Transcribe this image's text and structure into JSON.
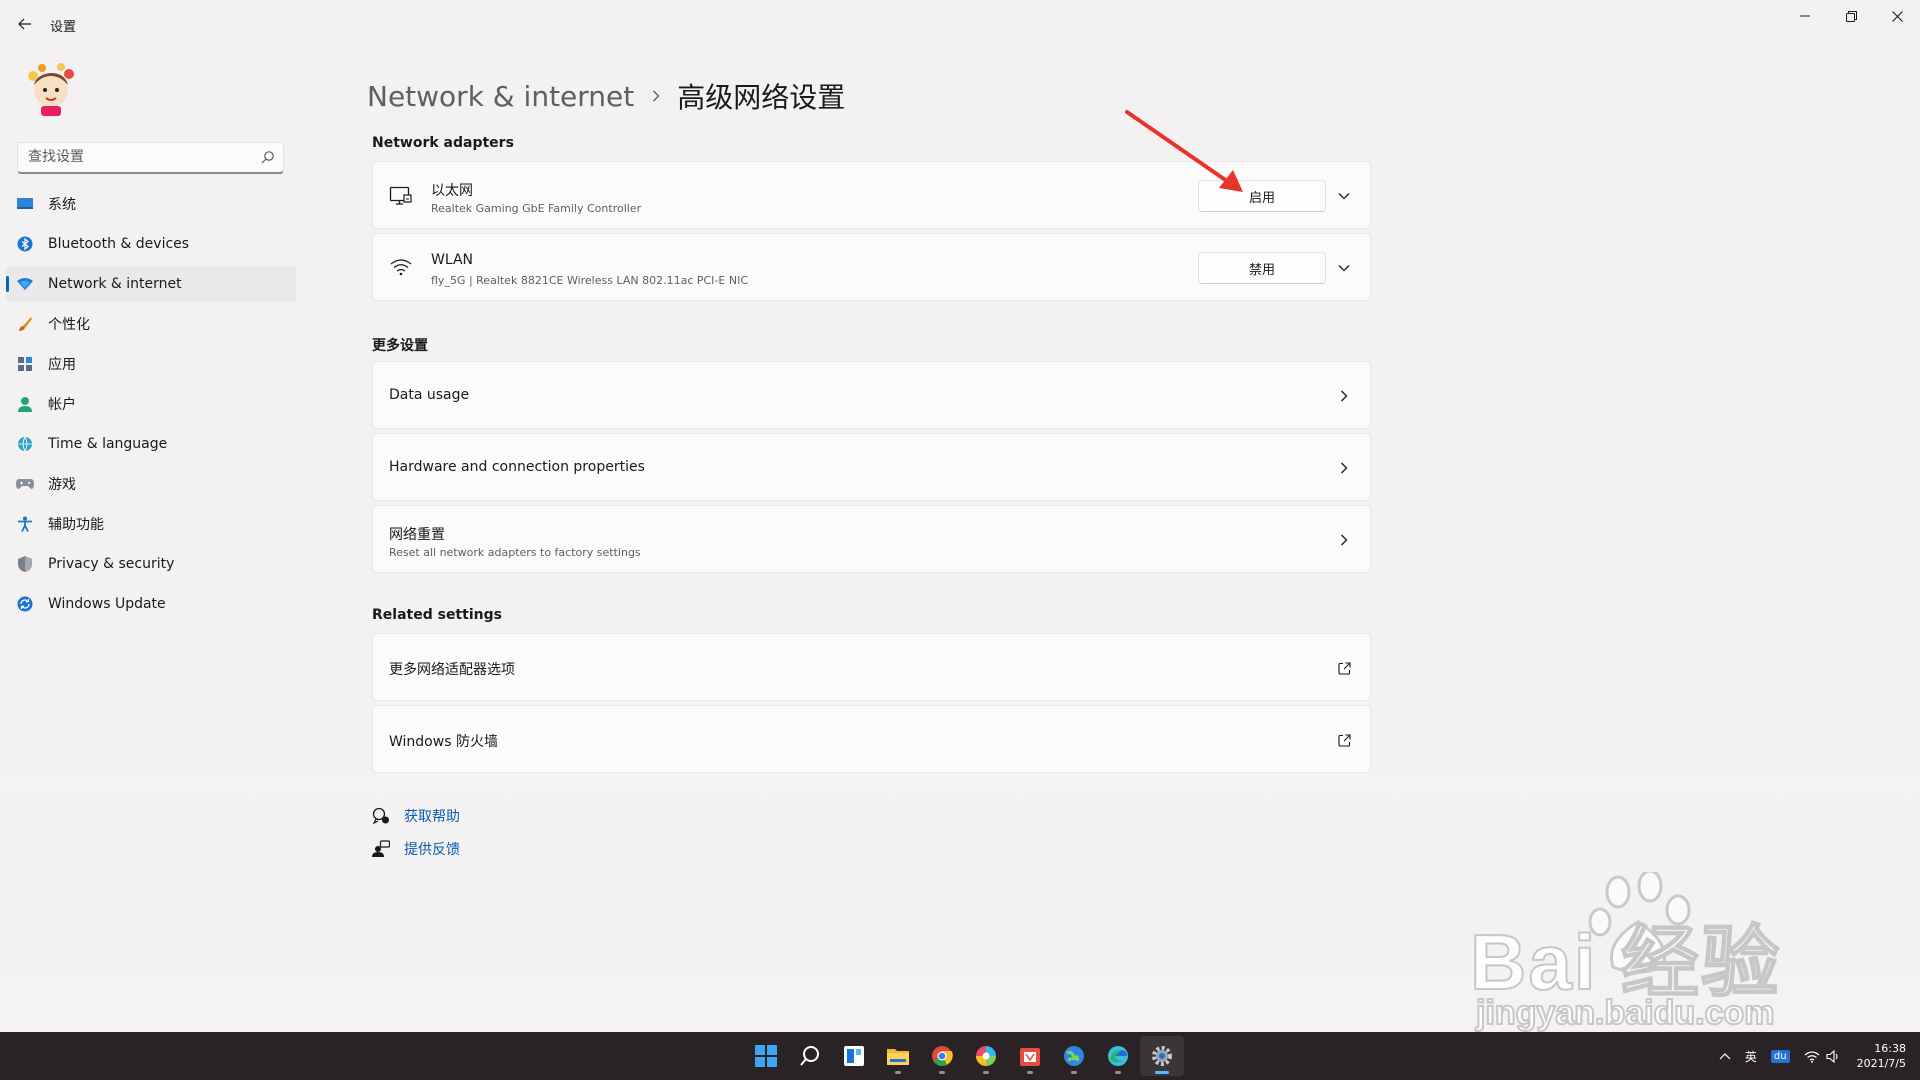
{
  "window": {
    "title": "设置"
  },
  "search": {
    "placeholder": "查找设置"
  },
  "sidebar": {
    "items": [
      {
        "label": "系统",
        "icon": "monitor-icon",
        "active": false
      },
      {
        "label": "Bluetooth & devices",
        "icon": "bluetooth-icon",
        "active": false
      },
      {
        "label": "Network & internet",
        "icon": "wifi-diamond-icon",
        "active": true
      },
      {
        "label": "个性化",
        "icon": "brush-icon",
        "active": false
      },
      {
        "label": "应用",
        "icon": "apps-icon",
        "active": false
      },
      {
        "label": "帐户",
        "icon": "person-icon",
        "active": false
      },
      {
        "label": "Time & language",
        "icon": "globe-clock-icon",
        "active": false
      },
      {
        "label": "游戏",
        "icon": "gamepad-icon",
        "active": false
      },
      {
        "label": "辅助功能",
        "icon": "accessibility-icon",
        "active": false
      },
      {
        "label": "Privacy & security",
        "icon": "shield-icon",
        "active": false
      },
      {
        "label": "Windows Update",
        "icon": "update-icon",
        "active": false
      }
    ]
  },
  "breadcrumb": {
    "parent": "Network & internet",
    "current": "高级网络设置"
  },
  "adapters": {
    "title": "Network adapters",
    "items": [
      {
        "name": "以太网",
        "desc": "Realtek Gaming GbE Family Controller",
        "button": "启用",
        "icon": "ethernet-icon"
      },
      {
        "name": "WLAN",
        "desc": "fly_5G | Realtek 8821CE Wireless LAN 802.11ac PCI-E NIC",
        "button": "禁用",
        "icon": "wifi-icon"
      }
    ]
  },
  "more": {
    "title": "更多设置",
    "items": [
      {
        "title": "Data usage"
      },
      {
        "title": "Hardware and connection properties"
      },
      {
        "title": "网络重置",
        "desc": "Reset all network adapters to factory settings"
      }
    ]
  },
  "related": {
    "title": "Related settings",
    "items": [
      {
        "title": "更多网络适配器选项"
      },
      {
        "title": "Windows 防火墙"
      }
    ]
  },
  "help": {
    "get_help": "获取帮助",
    "feedback": "提供反馈"
  },
  "watermark": {
    "main": "Bai  经验",
    "sub": "jingyan.baidu.com"
  },
  "taskbar": {
    "apps": [
      "start-icon",
      "search-icon",
      "widgets-icon",
      "file-explorer-icon",
      "chrome-icon",
      "color-app-icon",
      "store-app-icon",
      "network-globe-icon",
      "edge-icon",
      "settings-gear-icon"
    ],
    "tray": {
      "ime": "英",
      "app_badge": "du",
      "time": "16:38",
      "date": "2021/7/5"
    }
  },
  "colors": {
    "accent": "#0067c0",
    "link": "#0b5cad",
    "annotation": "#e8332a",
    "taskbar": "#292325"
  }
}
